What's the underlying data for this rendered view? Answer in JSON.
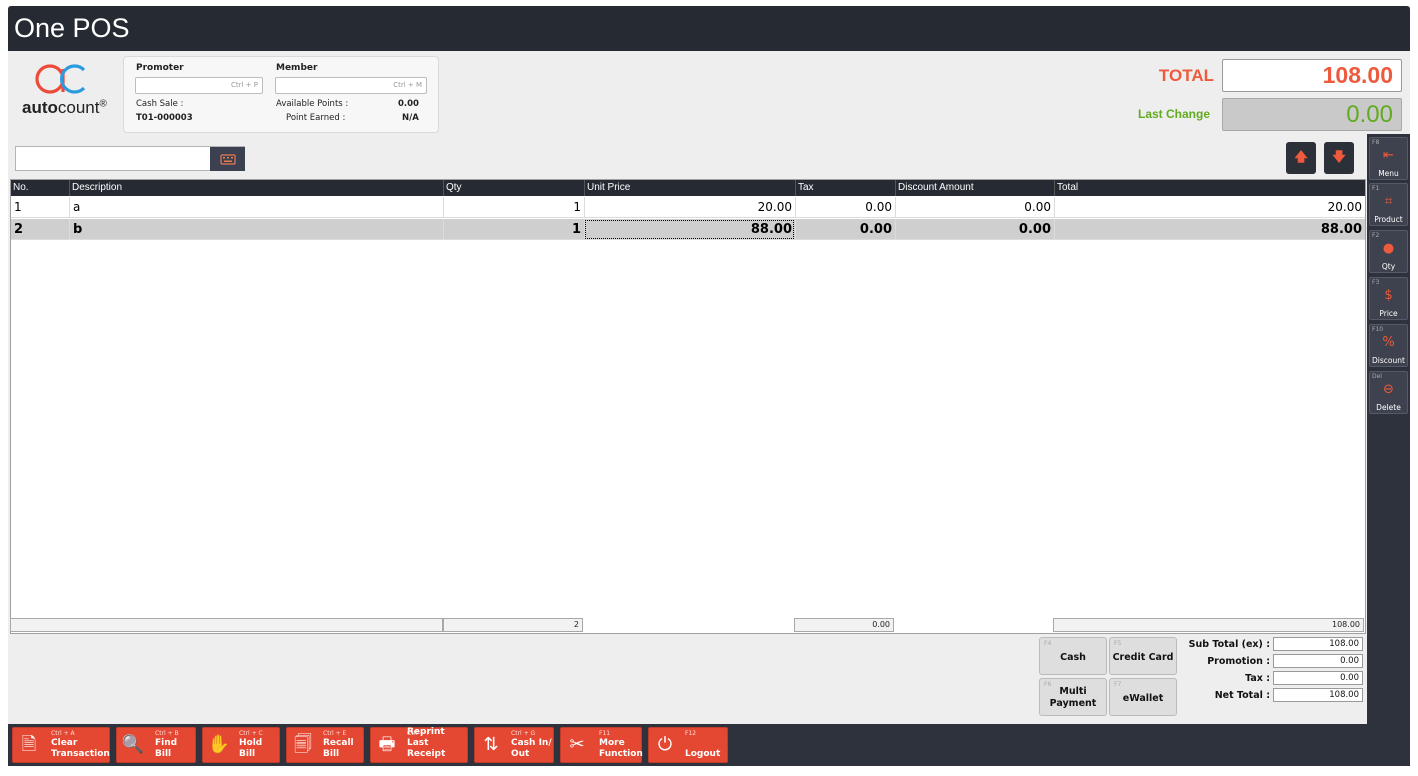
{
  "app": {
    "title": "One POS"
  },
  "logo": {
    "brand_bold": "auto",
    "brand_rest": "count",
    "reg": "®"
  },
  "promoter": {
    "label": "Promoter",
    "shortcut": "Ctrl + P",
    "value": ""
  },
  "member": {
    "label": "Member",
    "shortcut": "Ctrl + M",
    "value": ""
  },
  "info": {
    "cash_sale_label": "Cash Sale :",
    "bill_no": "T01-000003",
    "available_points_label": "Available Points :",
    "available_points_value": "0.00",
    "point_earned_label": "Point Earned :",
    "point_earned_value": "N/A"
  },
  "totals": {
    "total_label": "TOTAL",
    "total_value": "108.00",
    "last_change_label": "Last Change",
    "last_change_value": "0.00"
  },
  "scan": {
    "value": ""
  },
  "grid": {
    "columns": [
      "No.",
      "Description",
      "Qty",
      "Unit Price",
      "Tax",
      "Discount Amount",
      "Total"
    ],
    "rows": [
      {
        "no": "1",
        "description": "a",
        "qty": "1",
        "unit_price": "20.00",
        "tax": "0.00",
        "discount": "0.00",
        "total": "20.00"
      },
      {
        "no": "2",
        "description": "b",
        "qty": "1",
        "unit_price": "88.00",
        "tax": "0.00",
        "discount": "0.00",
        "total": "88.00"
      }
    ],
    "footer": {
      "qty": "2",
      "tax": "0.00",
      "total": "108.00"
    }
  },
  "side_buttons": [
    {
      "key": "F8",
      "label": "Menu"
    },
    {
      "key": "F1",
      "label": "Product"
    },
    {
      "key": "F2",
      "label": "Qty"
    },
    {
      "key": "F3",
      "label": "Price"
    },
    {
      "key": "F10",
      "label": "Discount"
    },
    {
      "key": "Del",
      "label": "Delete"
    }
  ],
  "payments": {
    "cash": {
      "key": "F4",
      "label": "Cash"
    },
    "credit_card": {
      "key": "F5",
      "label": "Credit Card"
    },
    "multi": {
      "key": "F6",
      "line1": "Multi",
      "line2": "Payment"
    },
    "ewallet": {
      "key": "F7",
      "label": "eWallet"
    }
  },
  "summary": {
    "subtotal_label": "Sub Total (ex) :",
    "subtotal": "108.00",
    "promotion_label": "Promotion :",
    "promotion": "0.00",
    "tax_label": "Tax :",
    "tax": "0.00",
    "net_label": "Net Total :",
    "net": "108.00"
  },
  "actions": [
    {
      "key": "Ctrl + A",
      "line1": "Clear",
      "line2": "Transaction"
    },
    {
      "key": "Ctrl + B",
      "line1": "",
      "line2": "Find Bill"
    },
    {
      "key": "Ctrl + C",
      "line1": "",
      "line2": "Hold Bill"
    },
    {
      "key": "Ctrl + E",
      "line1": "Recall",
      "line2": "Bill"
    },
    {
      "key": "Ctrl + F",
      "line1": "Reprint Last",
      "line2": "Receipt"
    },
    {
      "key": "Ctrl + G",
      "line1": "Cash In/",
      "line2": "Out"
    },
    {
      "key": "F11",
      "line1": "More",
      "line2": "Function"
    },
    {
      "key": "F12",
      "line1": "",
      "line2": "Logout"
    }
  ]
}
